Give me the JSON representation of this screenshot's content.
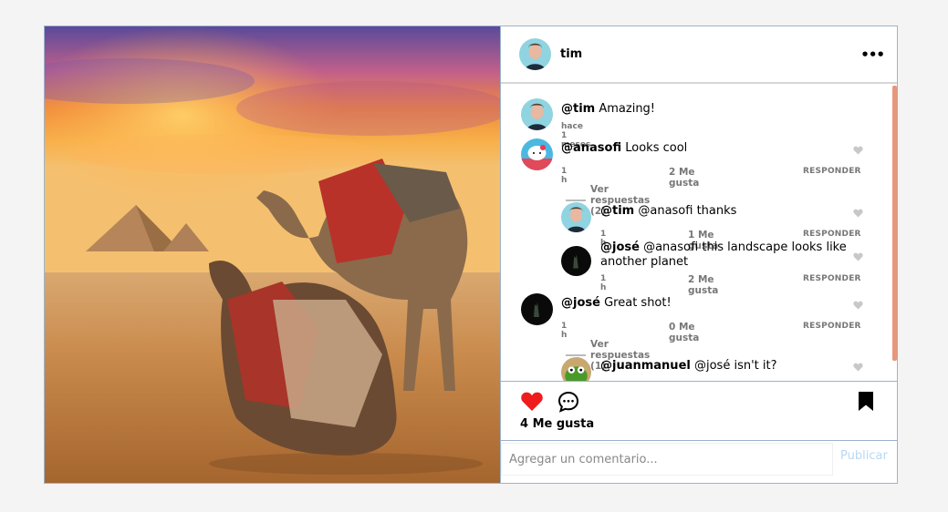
{
  "post": {
    "author": "tim",
    "more_label": "•••",
    "likes_text": "4 Me gusta",
    "comment_placeholder": "Agregar un comentario...",
    "publish_label": "Publicar"
  },
  "comments": [
    {
      "user": "@tim",
      "text": "Amazing!",
      "time": "hace 1 meses"
    },
    {
      "user": "@anasofi",
      "text": "Looks cool",
      "time": "1 h",
      "likes": "2 Me gusta",
      "reply": "RESPONDER",
      "view_replies": "Ver respuestas (2)"
    },
    {
      "user": "@tim",
      "text": "@anasofi thanks",
      "time": "1 h",
      "likes": "1 Me gusta",
      "reply": "RESPONDER"
    },
    {
      "user": "@josé",
      "text": "@anasofi this landscape looks like",
      "text2": "another planet",
      "time": "1 h",
      "likes": "2 Me gusta",
      "reply": "RESPONDER"
    },
    {
      "user": "@josé",
      "text": "Great shot!",
      "time": "1 h",
      "likes": "0 Me gusta",
      "reply": "RESPONDER",
      "view_replies": "Ver respuestas (1)"
    },
    {
      "user": "@juanmanuel",
      "text": "@josé isn't it?"
    }
  ],
  "colors": {
    "heart": "#ee1c1c",
    "accent_scroll": "#e8967a",
    "publish": "#b9d8f3"
  }
}
